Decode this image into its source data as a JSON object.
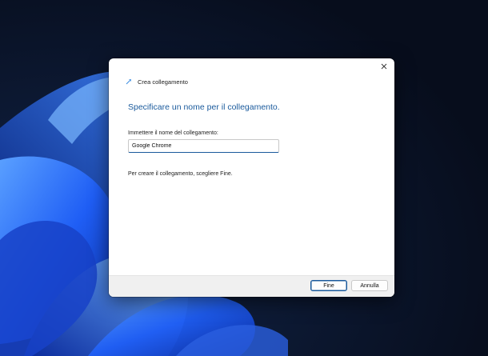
{
  "window": {
    "title": "Crea collegamento",
    "close_icon": "close-icon",
    "back_icon": "back-arrow-icon",
    "wizard_icon": "shortcut-wizard-icon"
  },
  "content": {
    "heading": "Specificare un nome per il collegamento.",
    "field_label": "Immettere il nome del collegamento:",
    "field_value": "Google Chrome",
    "instruction": "Per creare il collegamento, scegliere Fine."
  },
  "footer": {
    "finish_label": "Fine",
    "cancel_label": "Annulla"
  },
  "colors": {
    "accent": "#1a5a9c",
    "wallpaper_dark": "#0a1428",
    "wallpaper_blue": "#1f5ef5"
  }
}
